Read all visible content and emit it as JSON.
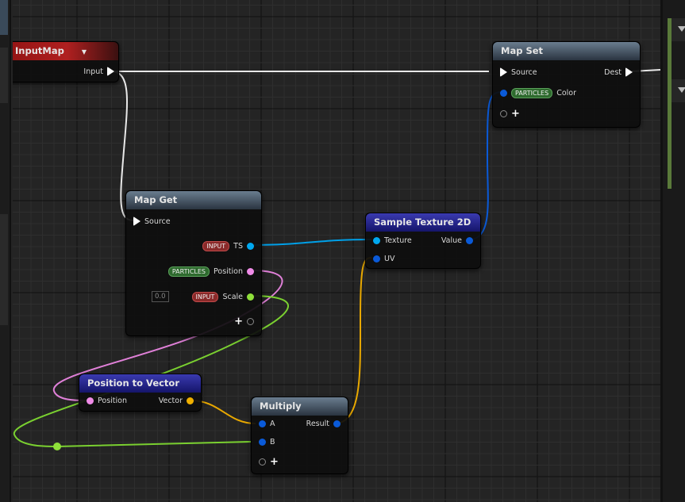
{
  "nodes": {
    "input_map": {
      "title": "InputMap",
      "pins": {
        "input": "Input"
      }
    },
    "map_get": {
      "title": "Map Get",
      "source": "Source",
      "pins": [
        {
          "namespace": "INPUT",
          "name": "TS"
        },
        {
          "namespace": "PARTICLES",
          "name": "Position"
        },
        {
          "namespace": "INPUT",
          "name": "Scale",
          "default": "0.0"
        }
      ]
    },
    "map_set": {
      "title": "Map Set",
      "source": "Source",
      "dest": "Dest",
      "pins": [
        {
          "namespace": "PARTICLES",
          "name": "Color"
        }
      ]
    },
    "sample_texture": {
      "title": "Sample Texture 2D",
      "inputs": [
        "Texture",
        "UV"
      ],
      "output": "Value"
    },
    "position_to_vector": {
      "title": "Position to Vector",
      "input": "Position",
      "output": "Vector"
    },
    "multiply": {
      "title": "Multiply",
      "inputs": [
        "A",
        "B"
      ],
      "output": "Result"
    }
  },
  "add_pin_symbol": "+",
  "colors": {
    "exec": "#ffffff",
    "texture": "#00a8f0",
    "vector_blue": "#0a5ad8",
    "position": "#f08ce8",
    "float": "#8fe03a",
    "vector": "#f0b000",
    "header_red": "#a01a1a",
    "header_blue": "#20209a",
    "header_gray": "#4a5a6a",
    "background": "#242424"
  }
}
